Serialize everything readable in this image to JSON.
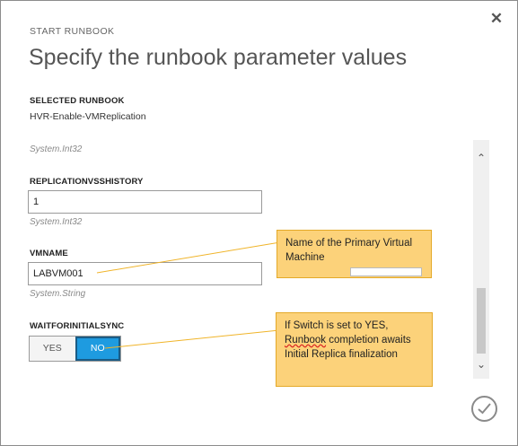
{
  "dialog": {
    "eyebrow": "START RUNBOOK",
    "title": "Specify the runbook parameter values",
    "close_glyph": "✕",
    "close_icon": "close-icon"
  },
  "selected_runbook": {
    "label": "SELECTED RUNBOOK",
    "value": "HVR-Enable-VMReplication"
  },
  "parameters": {
    "prev_type": "System.Int32",
    "replication_history": {
      "label": "REPLICATIONVSSHISTORY",
      "value": "1",
      "type": "System.Int32"
    },
    "vmname": {
      "label": "VMNAME",
      "value": "LABVM001",
      "type": "System.String"
    },
    "wait_sync": {
      "label": "WAITFORINITIALSYNC",
      "yes_label": "YES",
      "no_label": "NO",
      "selected": "NO"
    }
  },
  "scroll": {
    "up_glyph": "⌃",
    "down_glyph": "⌄"
  },
  "callouts": {
    "vmname_note": "Name of the Primary Virtual Machine",
    "switch_note_prefix": "If Switch is set to YES, ",
    "switch_note_underlined": "Runbook",
    "switch_note_suffix": " completion awaits Initial Replica finalization"
  },
  "colors": {
    "accent_blue": "#1e9be0",
    "callout_fill": "#fcd27a",
    "callout_border": "#e4a928"
  },
  "icons": {
    "ok": "checkmark-icon",
    "close": "close-icon"
  }
}
